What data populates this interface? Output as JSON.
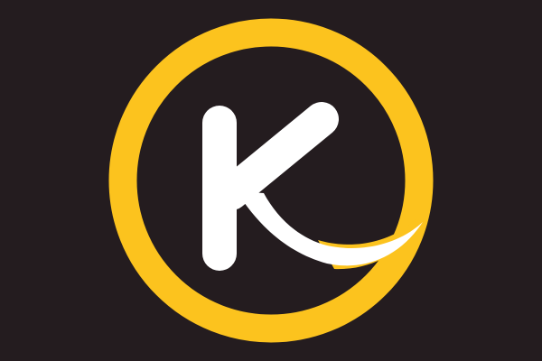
{
  "logo": {
    "letter": "K",
    "icon": "k-circle-logo-icon",
    "colors": {
      "background": "#241c1f",
      "ring": "#fcc31e",
      "letter": "#ffffff"
    }
  }
}
